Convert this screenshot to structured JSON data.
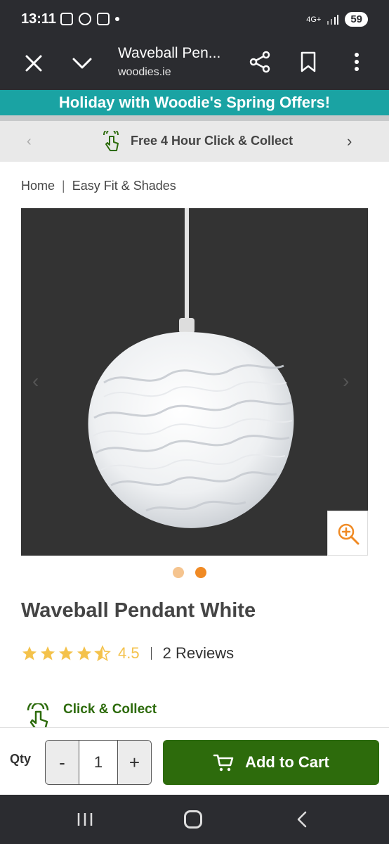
{
  "status_bar": {
    "time": "13:11",
    "network": "4G+",
    "battery": "59"
  },
  "browser": {
    "title": "Waveball Pen...",
    "domain": "woodies.ie"
  },
  "promo": {
    "text": "Holiday with Woodie's Spring Offers!"
  },
  "offer_strip": {
    "text": "Free 4 Hour Click & Collect"
  },
  "breadcrumb": {
    "items": [
      "Home",
      "Easy Fit & Shades"
    ]
  },
  "product": {
    "title": "Waveball Pendant White",
    "rating": "4.5",
    "rating_stars_value": 4.5,
    "reviews": "2 Reviews",
    "image_count": 2,
    "active_image": 2
  },
  "click_collect": {
    "title": "Click & Collect"
  },
  "cart": {
    "qty_label": "Qty",
    "minus": "-",
    "qty_value": "1",
    "plus": "+",
    "add_label": "Add to Cart"
  },
  "colors": {
    "teal": "#1aa3a3",
    "green": "#2d6b0c",
    "star": "#f4c24b",
    "orange": "#f08a24",
    "dark": "#2b2c30"
  }
}
